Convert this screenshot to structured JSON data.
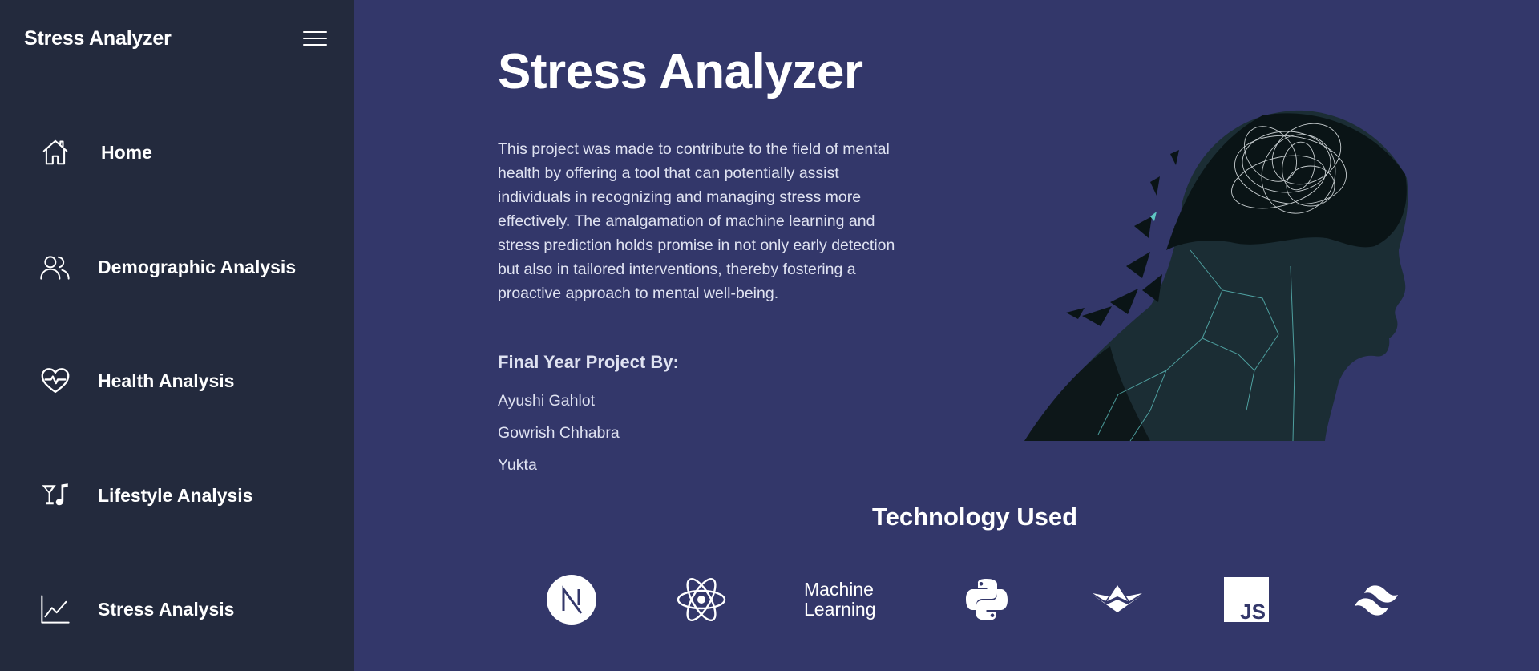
{
  "sidebar": {
    "brand": "Stress Analyzer",
    "items": [
      {
        "label": "Home",
        "icon": "home-icon"
      },
      {
        "label": "Demographic Analysis",
        "icon": "users-icon"
      },
      {
        "label": "Health Analysis",
        "icon": "heart-pulse-icon"
      },
      {
        "label": "Lifestyle Analysis",
        "icon": "cocktail-music-icon"
      },
      {
        "label": "Stress Analysis",
        "icon": "line-chart-icon"
      }
    ]
  },
  "main": {
    "title": "Stress Analyzer",
    "description": "This project was made to contribute to the field of mental health by offering a tool that can potentially assist individuals in recognizing and managing stress more effectively. The amalgamation of machine learning and stress prediction holds promise in not only early detection but also in tailored interventions, thereby fostering a proactive approach to mental well-being.",
    "project_by_heading": "Final Year Project By:",
    "members": [
      "Ayushi Gahlot",
      "Gowrish Chhabra",
      "Yukta"
    ],
    "technology_heading": "Technology Used",
    "technologies": [
      {
        "icon": "nextjs-icon"
      },
      {
        "icon": "react-icon"
      },
      {
        "icon": "machine-learning-label",
        "label_line1": "Machine",
        "label_line2": "Learning"
      },
      {
        "icon": "python-icon"
      },
      {
        "icon": "streamlit-icon"
      },
      {
        "icon": "javascript-icon",
        "label": "JS"
      },
      {
        "icon": "tailwind-icon"
      }
    ]
  },
  "colors": {
    "main_background": "#33376a",
    "sidebar_background": "#232a3d",
    "text": "#ffffff",
    "muted_text": "#dfe2f1"
  }
}
